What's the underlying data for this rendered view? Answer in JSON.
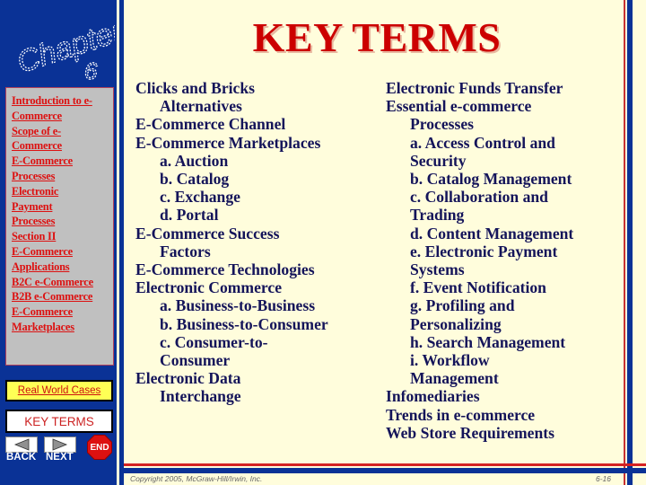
{
  "header": {
    "chapter_logo_text": "Chapter",
    "chapter_number": "6",
    "title": "KEY TERMS"
  },
  "sidebar": {
    "nav_links": [
      "Introduction to e-",
      "Commerce",
      "Scope of e-",
      "Commerce",
      "E-Commerce",
      "Processes",
      "Electronic",
      "Payment",
      "Processes",
      "Section II",
      "E-Commerce",
      "Applications",
      "B2C e-Commerce",
      "B2B e-Commerce",
      "E-Commerce",
      "Marketplaces"
    ],
    "real_world_cases": "Real World Cases",
    "key_terms": "KEY TERMS",
    "back_label": "BACK",
    "next_label": "NEXT",
    "end_label": "END"
  },
  "terms_left": [
    {
      "text": "Clicks and Bricks",
      "indent": false
    },
    {
      "text": "Alternatives",
      "indent": true
    },
    {
      "text": "E-Commerce Channel",
      "indent": false
    },
    {
      "text": "E-Commerce Marketplaces",
      "indent": false
    },
    {
      "text": "a. Auction",
      "indent": true
    },
    {
      "text": "b. Catalog",
      "indent": true
    },
    {
      "text": "c. Exchange",
      "indent": true
    },
    {
      "text": "d. Portal",
      "indent": true
    },
    {
      "text": "E-Commerce Success",
      "indent": false
    },
    {
      "text": "Factors",
      "indent": true
    },
    {
      "text": "E-Commerce Technologies",
      "indent": false
    },
    {
      "text": "Electronic Commerce",
      "indent": false
    },
    {
      "text": "a. Business-to-Business",
      "indent": true
    },
    {
      "text": "b. Business-to-Consumer",
      "indent": true
    },
    {
      "text": "c. Consumer-to-",
      "indent": true
    },
    {
      "text": "Consumer",
      "indent": true
    },
    {
      "text": "Electronic Data",
      "indent": false
    },
    {
      "text": "Interchange",
      "indent": true
    }
  ],
  "terms_right": [
    {
      "text": "Electronic Funds Transfer",
      "indent": false
    },
    {
      "text": "Essential e-commerce",
      "indent": false
    },
    {
      "text": "Processes",
      "indent": true
    },
    {
      "text": "a. Access Control and",
      "indent": true
    },
    {
      "text": "Security",
      "indent": true
    },
    {
      "text": "b. Catalog Management",
      "indent": true
    },
    {
      "text": "c. Collaboration and",
      "indent": true
    },
    {
      "text": "Trading",
      "indent": true
    },
    {
      "text": "d. Content Management",
      "indent": true
    },
    {
      "text": "e. Electronic Payment",
      "indent": true
    },
    {
      "text": "Systems",
      "indent": true
    },
    {
      "text": "f. Event Notification",
      "indent": true
    },
    {
      "text": "g. Profiling and",
      "indent": true
    },
    {
      "text": "Personalizing",
      "indent": true
    },
    {
      "text": "h. Search Management",
      "indent": true
    },
    {
      "text": "i. Workflow",
      "indent": true
    },
    {
      "text": "Management",
      "indent": true
    },
    {
      "text": "Infomediaries",
      "indent": false
    },
    {
      "text": "Trends in e-commerce",
      "indent": false
    },
    {
      "text": "Web Store Requirements",
      "indent": false
    }
  ],
  "footer": {
    "copyright": "Copyright 2005, McGraw-Hill/Irwin, Inc.",
    "page_number": "6-16"
  },
  "colors": {
    "sidebar_blue": "#0a3296",
    "title_red": "#cc0000",
    "link_red": "#dd1111",
    "term_navy": "#14145a",
    "background": "#fffddc"
  }
}
